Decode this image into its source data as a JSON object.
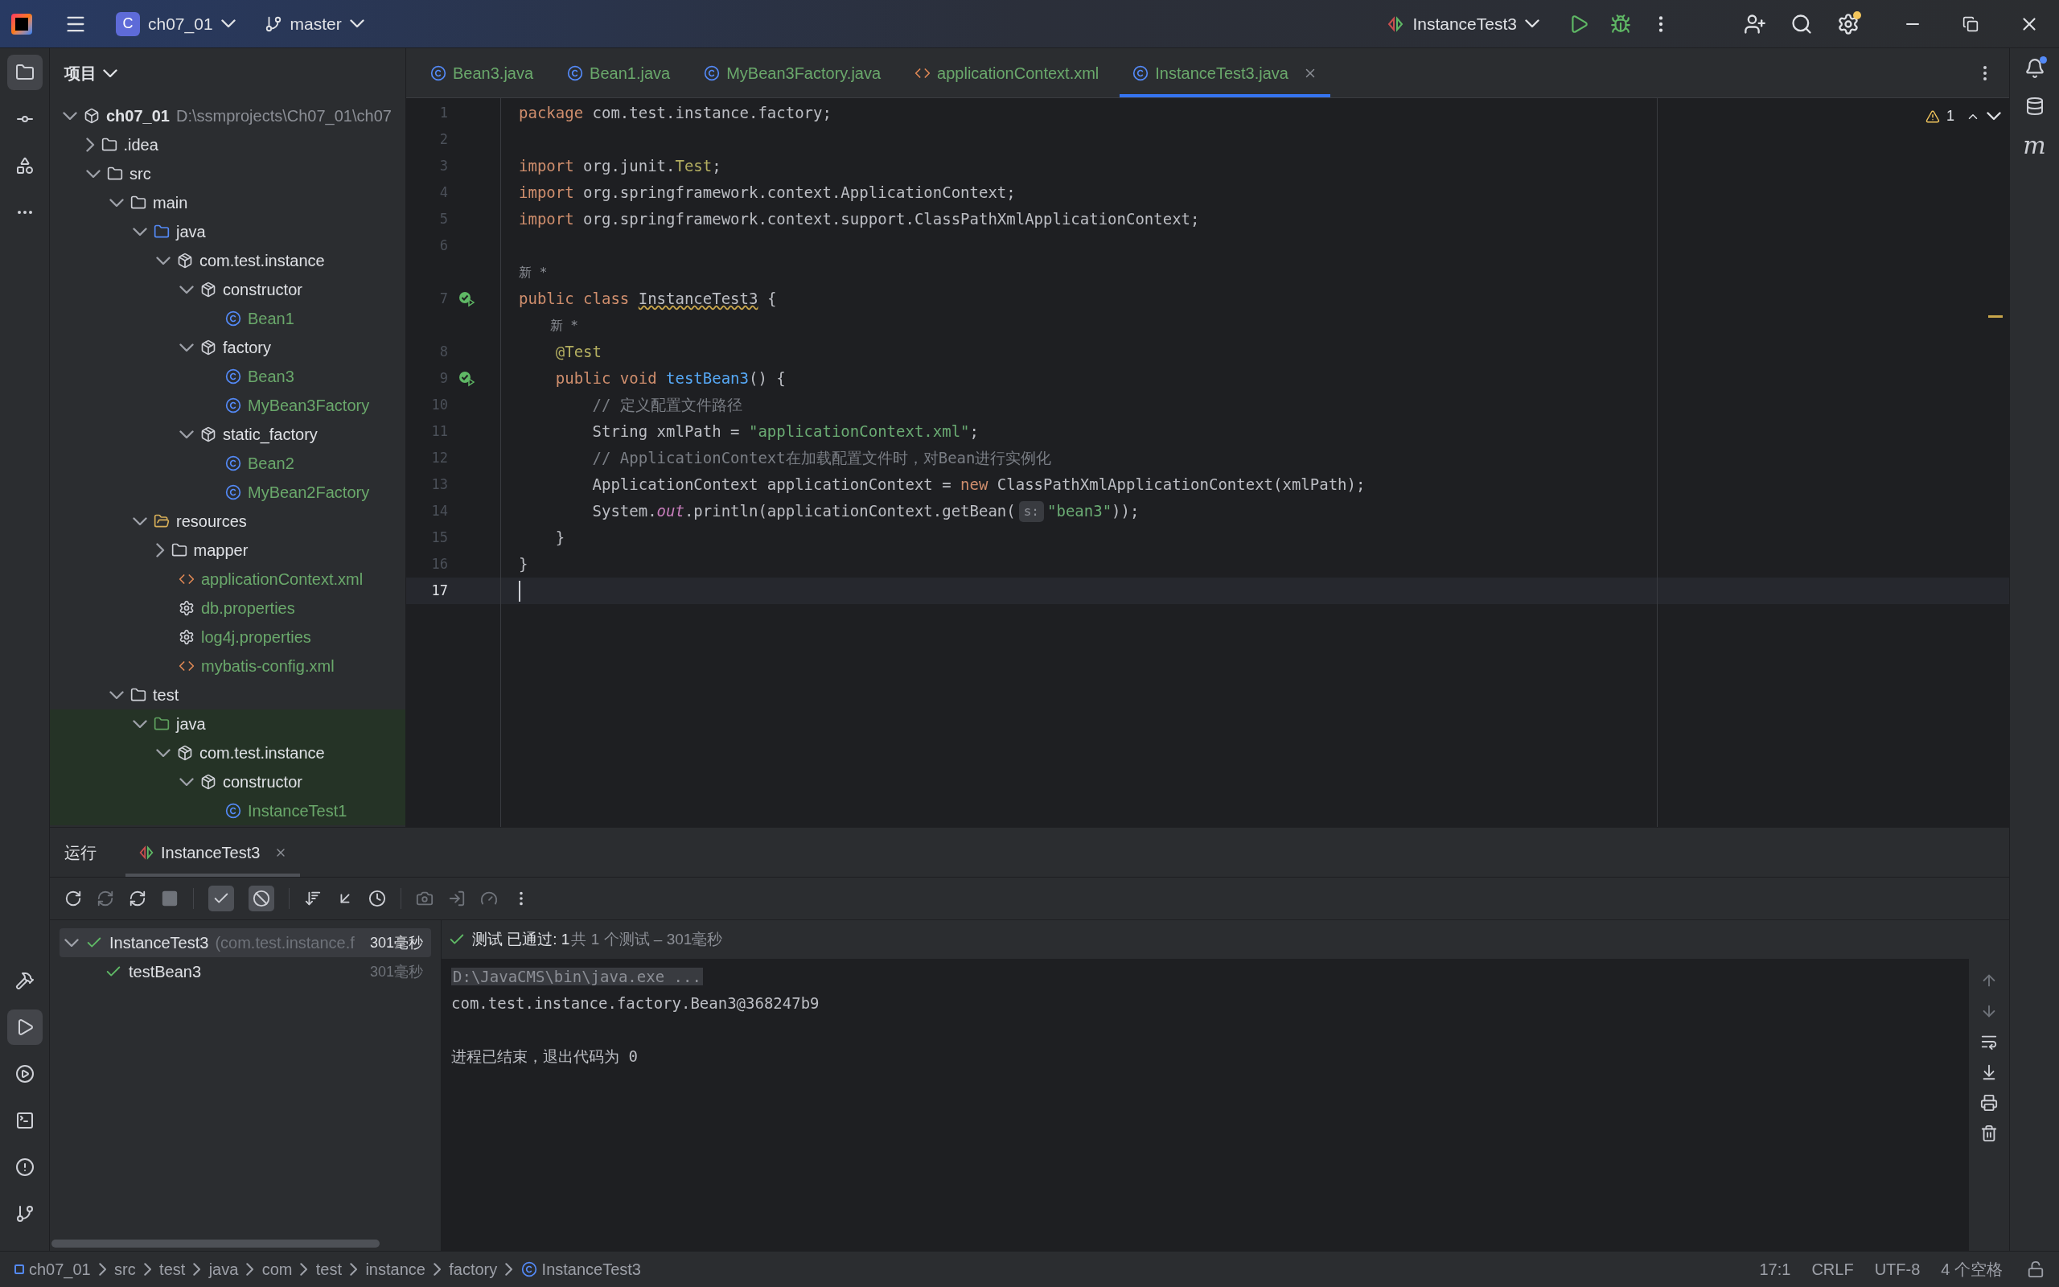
{
  "title_bar": {
    "project_badge": "C",
    "project": "ch07_01",
    "branch": "master",
    "run_config": "InstanceTest3"
  },
  "project_panel": {
    "title": "项目",
    "tree": [
      {
        "label": "ch07_01",
        "kind": "module",
        "path": "D:\\ssmprojects\\Ch07_01\\ch07",
        "expanded": true,
        "children": [
          {
            "label": ".idea",
            "kind": "folder",
            "expanded": false
          },
          {
            "label": "src",
            "kind": "folder",
            "expanded": true,
            "children": [
              {
                "label": "main",
                "kind": "folder",
                "expanded": true,
                "children": [
                  {
                    "label": "java",
                    "kind": "source-root",
                    "expanded": true,
                    "children": [
                      {
                        "label": "com.test.instance",
                        "kind": "package",
                        "expanded": true,
                        "children": [
                          {
                            "label": "constructor",
                            "kind": "package",
                            "expanded": true,
                            "children": [
                              {
                                "label": "Bean1",
                                "kind": "class"
                              }
                            ]
                          },
                          {
                            "label": "factory",
                            "kind": "package",
                            "expanded": true,
                            "children": [
                              {
                                "label": "Bean3",
                                "kind": "class"
                              },
                              {
                                "label": "MyBean3Factory",
                                "kind": "class"
                              }
                            ]
                          },
                          {
                            "label": "static_factory",
                            "kind": "package",
                            "expanded": true,
                            "children": [
                              {
                                "label": "Bean2",
                                "kind": "class"
                              },
                              {
                                "label": "MyBean2Factory",
                                "kind": "class"
                              }
                            ]
                          }
                        ]
                      }
                    ]
                  },
                  {
                    "label": "resources",
                    "kind": "resources-root",
                    "expanded": true,
                    "children": [
                      {
                        "label": "mapper",
                        "kind": "folder",
                        "expanded": false
                      },
                      {
                        "label": "applicationContext.xml",
                        "kind": "spring-xml"
                      },
                      {
                        "label": "db.properties",
                        "kind": "properties"
                      },
                      {
                        "label": "log4j.properties",
                        "kind": "properties"
                      },
                      {
                        "label": "mybatis-config.xml",
                        "kind": "xml"
                      }
                    ]
                  }
                ]
              },
              {
                "label": "test",
                "kind": "folder",
                "expanded": true,
                "children": [
                  {
                    "label": "java",
                    "kind": "test-root",
                    "expanded": true,
                    "children": [
                      {
                        "label": "com.test.instance",
                        "kind": "package",
                        "expanded": true,
                        "children": [
                          {
                            "label": "constructor",
                            "kind": "package",
                            "expanded": true,
                            "children": [
                              {
                                "label": "InstanceTest1",
                                "kind": "class"
                              }
                            ]
                          }
                        ]
                      }
                    ]
                  }
                ]
              }
            ]
          }
        ]
      }
    ]
  },
  "editor_tabs": [
    {
      "label": "Bean3.java",
      "kind": "class",
      "selected": false
    },
    {
      "label": "Bean1.java",
      "kind": "class",
      "selected": false
    },
    {
      "label": "MyBean3Factory.java",
      "kind": "class",
      "selected": false
    },
    {
      "label": "applicationContext.xml",
      "kind": "spring-xml",
      "selected": false
    },
    {
      "label": "InstanceTest3.java",
      "kind": "class",
      "selected": true
    }
  ],
  "editor": {
    "warnings": "1",
    "lines": [
      {
        "number": "1",
        "current": false,
        "tokens": [
          {
            "kind": "kw",
            "s": "package"
          },
          {
            "kind": "plain",
            "s": " com.test.instance.factory;"
          }
        ]
      },
      {
        "number": "2",
        "current": false
      },
      {
        "number": "3",
        "current": false,
        "tokens": [
          {
            "kind": "kw",
            "s": "import"
          },
          {
            "kind": "plain",
            "s": " org.junit."
          },
          {
            "kind": "annotation",
            "s": "Test"
          },
          {
            "kind": "plain",
            "s": ";"
          }
        ]
      },
      {
        "number": "4",
        "current": false,
        "tokens": [
          {
            "kind": "kw",
            "s": "import"
          },
          {
            "kind": "plain",
            "s": " org.springframework.context.ApplicationContext;"
          }
        ]
      },
      {
        "number": "5",
        "current": false,
        "tokens": [
          {
            "kind": "kw",
            "s": "import"
          },
          {
            "kind": "plain",
            "s": " org.springframework.context.support.ClassPathXmlApplicationContext;"
          }
        ]
      },
      {
        "number": "6",
        "current": false
      },
      {
        "kind": "hint",
        "text": "新 *"
      },
      {
        "number": "7",
        "current": false,
        "gutter": {
          "kind": "run"
        },
        "tokens": [
          {
            "kind": "kw",
            "s": "public class "
          },
          {
            "kind": "warn",
            "s": "InstanceTest3"
          },
          {
            "kind": "plain",
            "s": " {"
          }
        ]
      },
      {
        "kind": "hint",
        "text": "    新 *"
      },
      {
        "number": "8",
        "current": false,
        "tokens": [
          {
            "kind": "annotation",
            "s": "    @Test"
          }
        ]
      },
      {
        "number": "9",
        "current": false,
        "gutter": {
          "kind": "run"
        },
        "tokens": [
          {
            "kind": "kw",
            "s": "    public void "
          },
          {
            "kind": "method",
            "s": "testBean3"
          },
          {
            "kind": "plain",
            "s": "() {"
          }
        ]
      },
      {
        "number": "10",
        "current": false,
        "tokens": [
          {
            "kind": "comment",
            "s": "        // 定义配置文件路径"
          }
        ]
      },
      {
        "number": "11",
        "current": false,
        "tokens": [
          {
            "kind": "plain",
            "s": "        String xmlPath = "
          },
          {
            "kind": "string",
            "s": "\"applicationContext.xml\""
          },
          {
            "kind": "plain",
            "s": ";"
          }
        ]
      },
      {
        "number": "12",
        "current": false,
        "tokens": [
          {
            "kind": "comment",
            "s": "        // ApplicationContext在加载配置文件时，对Bean进行实例化"
          }
        ]
      },
      {
        "number": "13",
        "current": false,
        "tokens": [
          {
            "kind": "plain",
            "s": "        ApplicationContext applicationContext = "
          },
          {
            "kind": "kw",
            "s": "new"
          },
          {
            "kind": "plain",
            "s": " ClassPathXmlApplicationContext(xmlPath);"
          }
        ]
      },
      {
        "number": "14",
        "current": false,
        "tokens": [
          {
            "kind": "plain",
            "s": "        System."
          },
          {
            "kind": "static",
            "s": "out"
          },
          {
            "kind": "plain",
            "s": ".println(applicationContext.getBean("
          },
          {
            "kind": "param",
            "s": "s:"
          },
          {
            "kind": "string",
            "s": "\"bean3\""
          },
          {
            "kind": "plain",
            "s": "));"
          }
        ]
      },
      {
        "number": "15",
        "current": false,
        "tokens": [
          {
            "kind": "plain",
            "s": "    }"
          }
        ]
      },
      {
        "number": "16",
        "current": false,
        "tokens": [
          {
            "kind": "plain",
            "s": "}"
          }
        ]
      },
      {
        "number": "17",
        "current": true
      }
    ]
  },
  "right_strip": {
    "maven": "m"
  },
  "run_panel": {
    "title": "运行",
    "tabs": [
      {
        "label": "InstanceTest3",
        "selected": true
      }
    ],
    "toggles": [
      {
        "kind": "show-passed",
        "on": true
      },
      {
        "kind": "show-ignored",
        "on": true
      }
    ],
    "tests": [
      {
        "name": "InstanceTest3",
        "detail": "(com.test.instance.f",
        "time": "301毫秒",
        "passed": true,
        "selected": true,
        "children": [
          {
            "name": "testBean3",
            "time": "301毫秒",
            "passed": true,
            "selected": false
          }
        ]
      }
    ],
    "summary": {
      "status": "测试 已通过: 1",
      "detail": "共 1 个测试 – 301毫秒"
    },
    "console": [
      {
        "kind": "command",
        "text": "D:\\JavaCMS\\bin\\java.exe ..."
      },
      {
        "kind": "output",
        "text": "com.test.instance.factory.Bean3@368247b9"
      },
      {
        "kind": "blank"
      },
      {
        "kind": "output",
        "text": "进程已结束，退出代码为 0"
      }
    ]
  },
  "status_bar": {
    "breadcrumbs": [
      {
        "label": "ch07_01",
        "kind": "module"
      },
      {
        "label": "src",
        "kind": "folder"
      },
      {
        "label": "test",
        "kind": "folder"
      },
      {
        "label": "java",
        "kind": "folder"
      },
      {
        "label": "com",
        "kind": "folder"
      },
      {
        "label": "test",
        "kind": "folder"
      },
      {
        "label": "instance",
        "kind": "folder"
      },
      {
        "label": "factory",
        "kind": "folder"
      },
      {
        "label": "InstanceTest3",
        "kind": "class"
      }
    ],
    "position": "17:1",
    "line_separator": "CRLF",
    "encoding": "UTF-8",
    "indent": "4 个空格"
  }
}
